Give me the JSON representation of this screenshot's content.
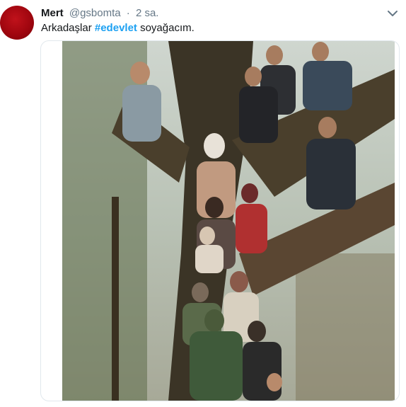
{
  "tweet": {
    "author_name": "Mert",
    "handle": "@gsbomta",
    "separator": "·",
    "time": "2 sa.",
    "text_before": "Arkadaşlar ",
    "hashtag": "#edevlet",
    "text_after": " soyağacım.",
    "avatar_color": "#b00d16"
  },
  "icons": {
    "more_menu": "chevron-down-icon"
  },
  "colors": {
    "hashtag": "#1da1f2",
    "secondary_text": "#657786",
    "border": "#e1e8ed"
  }
}
